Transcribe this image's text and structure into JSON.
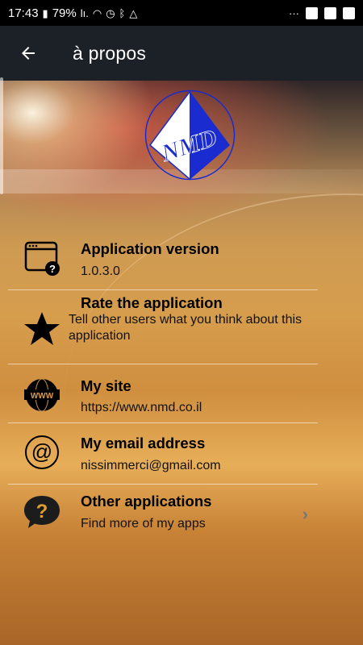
{
  "status_bar": {
    "time": "17:43",
    "battery": "79%"
  },
  "app_bar": {
    "title": "à propos",
    "back_icon": "arrow-left-icon"
  },
  "logo": {
    "text": "NMD",
    "colors": {
      "blue": "#1a2bd0",
      "white": "#ffffff"
    }
  },
  "items": [
    {
      "title": "Application version",
      "subtitle": "1.0.3.0",
      "icon": "app-info-icon"
    },
    {
      "title": "Rate the application",
      "subtitle": "Tell other users what you think about this application",
      "icon": "star-icon"
    },
    {
      "title": "My site",
      "subtitle": "https://www.nmd.co.il",
      "icon": "www-icon"
    },
    {
      "title": "My email address",
      "subtitle": "nissimmerci@gmail.com",
      "icon": "at-icon"
    },
    {
      "title": "Other applications",
      "subtitle": "Find more of my apps",
      "icon": "question-bubble-icon"
    }
  ]
}
